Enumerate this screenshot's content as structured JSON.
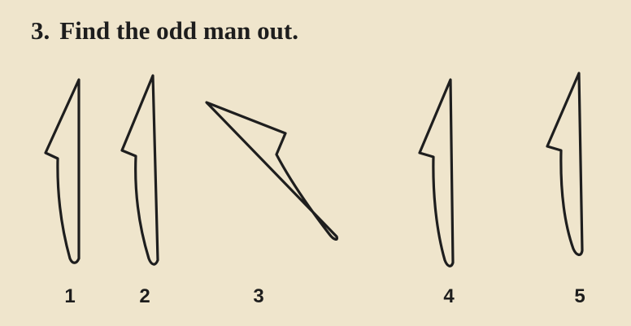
{
  "question": {
    "number": "3.",
    "text": "Find the odd man out."
  },
  "options": [
    {
      "label": "1"
    },
    {
      "label": "2"
    },
    {
      "label": "3"
    },
    {
      "label": "4"
    },
    {
      "label": "5"
    }
  ]
}
